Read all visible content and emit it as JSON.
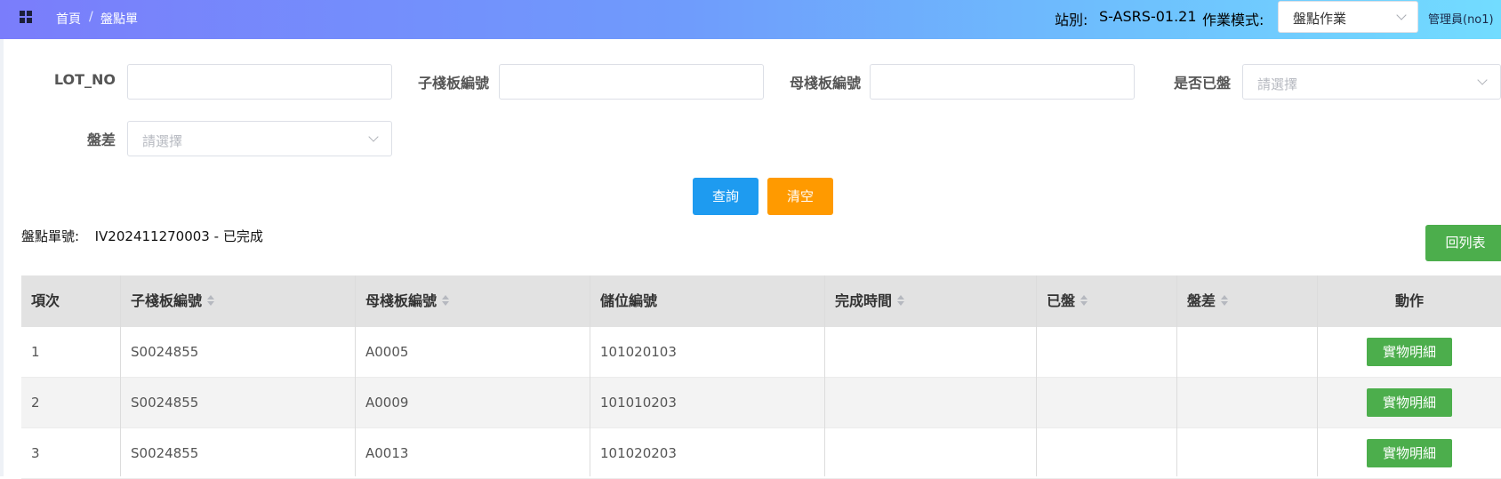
{
  "header": {
    "breadcrumb_home": "首頁",
    "breadcrumb_sep": "/",
    "breadcrumb_current": "盤點單",
    "station_label": "站別:",
    "station_value": "S-ASRS-01.21",
    "mode_label": "作業模式:",
    "mode_value": "盤點作業",
    "user": "管理員(no1)"
  },
  "filters": {
    "lot_no_label": "LOT_NO",
    "child_board_label": "子棧板編號",
    "parent_board_label": "母棧板編號",
    "counted_label": "是否已盤",
    "counted_placeholder": "請選擇",
    "diff_label": "盤差",
    "diff_placeholder": "請選擇",
    "query_button": "查詢",
    "clear_button": "清空"
  },
  "order": {
    "label": "盤點單號:",
    "number": "IV202411270003",
    "status": "已完成",
    "back_button": "回列表"
  },
  "table": {
    "columns": [
      "項次",
      "子棧板編號",
      "母棧板編號",
      "儲位編號",
      "完成時間",
      "已盤",
      "盤差",
      "動作"
    ],
    "rows": [
      {
        "item": "1",
        "child": "S0024855",
        "parent": "A0005",
        "location": "101020103",
        "done_time": "",
        "counted": "",
        "diff": "",
        "action": "實物明細"
      },
      {
        "item": "2",
        "child": "S0024855",
        "parent": "A0009",
        "location": "101010203",
        "done_time": "",
        "counted": "",
        "diff": "",
        "action": "實物明細"
      },
      {
        "item": "3",
        "child": "S0024855",
        "parent": "A0013",
        "location": "101020203",
        "done_time": "",
        "counted": "",
        "diff": "",
        "action": "實物明細"
      }
    ]
  },
  "colors": {
    "primary": "#1e9bf0",
    "warning": "#ff9a00",
    "success": "#4cae4c"
  },
  "icons": {
    "menu": "apps-grid-icon",
    "chevron": "chevron-down-icon",
    "sort": "sort-caret-icon"
  }
}
